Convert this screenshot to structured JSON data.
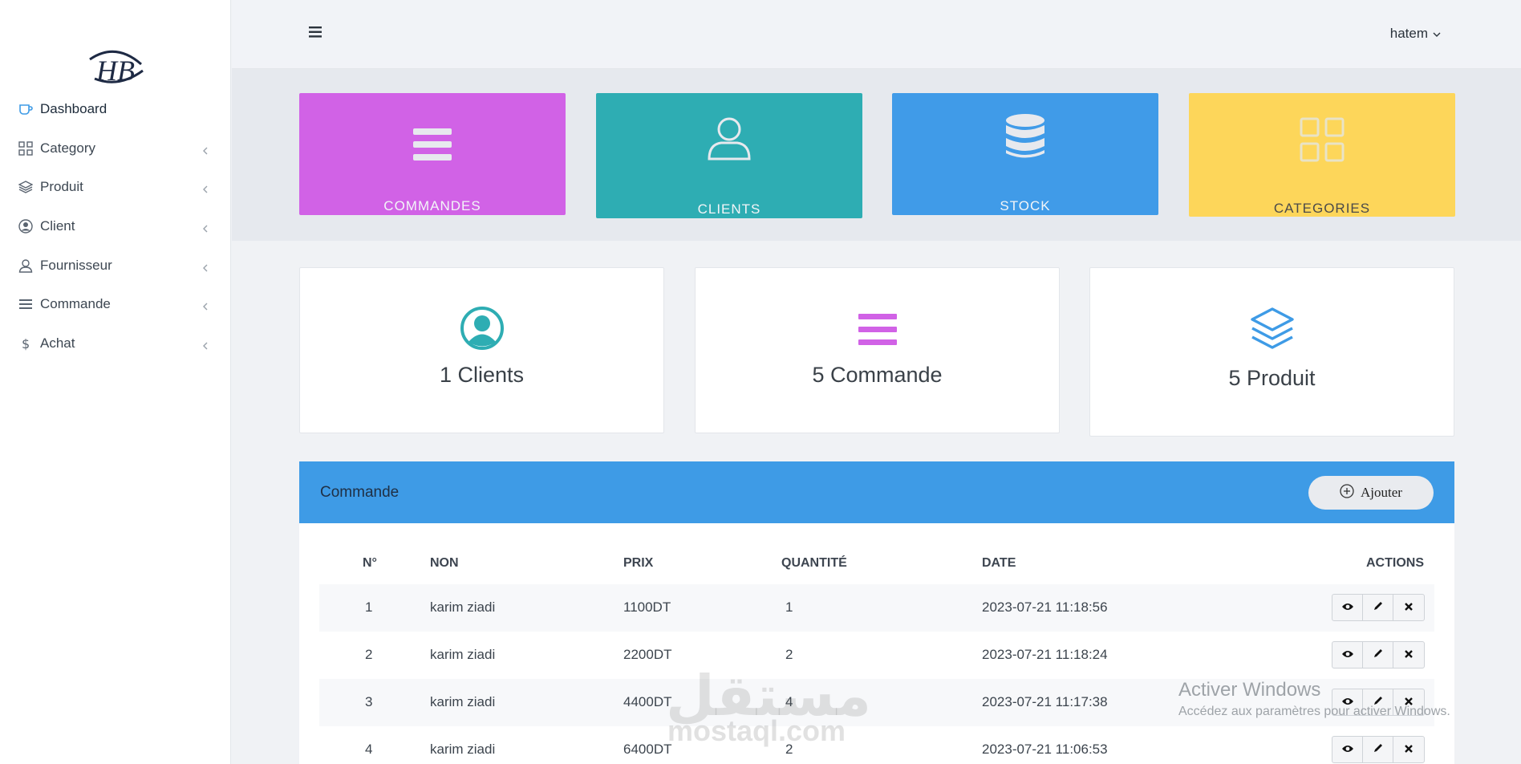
{
  "sidebar": {
    "logo_text": "HB",
    "items": [
      {
        "label": "Dashboard",
        "icon": "coffee-icon"
      },
      {
        "label": "Category",
        "icon": "grid-icon"
      },
      {
        "label": "Produit",
        "icon": "layers-icon"
      },
      {
        "label": "Client",
        "icon": "user-circle-icon"
      },
      {
        "label": "Fournisseur",
        "icon": "user-icon"
      },
      {
        "label": "Commande",
        "icon": "list-icon"
      },
      {
        "label": "Achat",
        "icon": "dollar-icon"
      }
    ]
  },
  "topbar": {
    "user": "hatem"
  },
  "tiles": [
    {
      "label": "COMMANDES",
      "color": "#d162e6"
    },
    {
      "label": "CLIENTS",
      "color": "#2eadb3"
    },
    {
      "label": "STOCK",
      "color": "#409be8"
    },
    {
      "label": "CATEGORIES",
      "color": "#fdd65a"
    }
  ],
  "stats": [
    {
      "text": "1 Clients",
      "color": "#2eadb3"
    },
    {
      "text": "5 Commande",
      "color": "#d162e6"
    },
    {
      "text": "5 Produit",
      "color": "#3e9be6"
    }
  ],
  "table": {
    "title": "Commande",
    "add_label": "Ajouter",
    "columns": [
      "N°",
      "NON",
      "PRIX",
      "QUANTITÉ",
      "DATE",
      "ACTIONS"
    ],
    "rows": [
      {
        "n": "1",
        "nom": "karim ziadi",
        "prix": "1100DT",
        "quantite": "1",
        "date": "2023-07-21 11:18:56"
      },
      {
        "n": "2",
        "nom": "karim ziadi",
        "prix": "2200DT",
        "quantite": "2",
        "date": "2023-07-21 11:18:24"
      },
      {
        "n": "3",
        "nom": "karim ziadi",
        "prix": "4400DT",
        "quantite": "4",
        "date": "2023-07-21 11:17:38"
      },
      {
        "n": "4",
        "nom": "karim ziadi",
        "prix": "6400DT",
        "quantite": "2",
        "date": "2023-07-21 11:06:53"
      }
    ]
  },
  "overlay": {
    "watermark": "مستقل",
    "watermark_url": "mostaql.com",
    "windows_title": "Activer Windows",
    "windows_sub": "Accédez aux paramètres pour activer Windows."
  }
}
